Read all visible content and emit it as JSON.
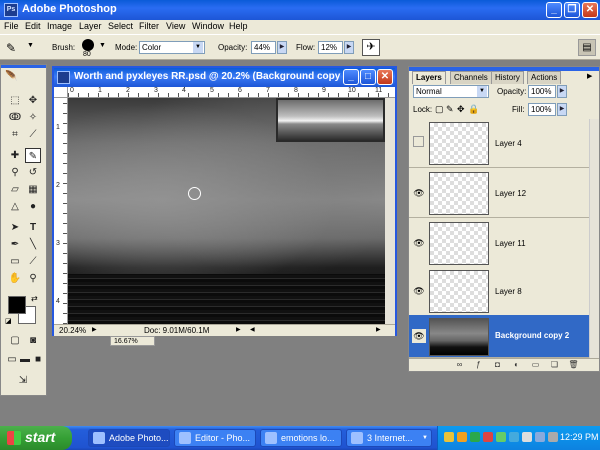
{
  "app": {
    "title": "Adobe Photoshop",
    "icon": "photoshop-icon"
  },
  "menu": [
    "File",
    "Edit",
    "Image",
    "Layer",
    "Select",
    "Filter",
    "View",
    "Window",
    "Help"
  ],
  "options": {
    "brush_label": "Brush:",
    "brush_size": "80",
    "mode_label": "Mode:",
    "mode_value": "Color",
    "opacity_label": "Opacity:",
    "opacity_value": "44%",
    "flow_label": "Flow:",
    "flow_value": "12%"
  },
  "document": {
    "title": "Worth and pyxleyes RR.psd @ 20.2% (Background copy ...",
    "zoom": "20.24%",
    "doc_info": "Doc: 9.01M/60.1M",
    "ruler_h": [
      "0",
      "1",
      "2",
      "3",
      "4",
      "5",
      "6",
      "7",
      "8",
      "9",
      "10",
      "11"
    ],
    "ruler_v": [
      "1",
      "2",
      "3",
      "4"
    ]
  },
  "background_doc_zoom": "16.67%",
  "layers_panel": {
    "tabs": [
      "Layers",
      "Channels",
      "History",
      "Actions"
    ],
    "blend_mode": "Normal",
    "opacity_label": "Opacity:",
    "opacity_value": "100%",
    "lock_label": "Lock:",
    "fill_label": "Fill:",
    "fill_value": "100%",
    "layers": [
      {
        "name": "Layer 4",
        "visible": false,
        "selected": false
      },
      {
        "name": "Layer 12",
        "visible": true,
        "selected": false
      },
      {
        "name": "Layer 11",
        "visible": true,
        "selected": false
      },
      {
        "name": "Layer 8",
        "visible": true,
        "selected": false
      },
      {
        "name": "Background copy 2",
        "visible": true,
        "selected": true
      }
    ]
  },
  "taskbar": {
    "start_label": "start",
    "tasks": [
      "Adobe Photo...",
      "Editor - Pho...",
      "emotions lo...",
      "3 Internet..."
    ],
    "clock": "12:29 PM"
  }
}
